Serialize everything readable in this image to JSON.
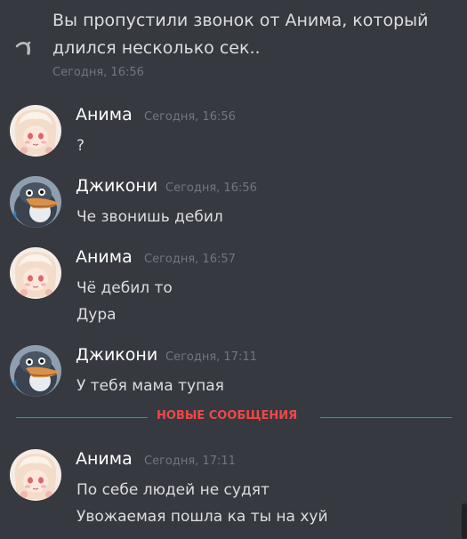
{
  "system_message": {
    "text_line1": "Вы пропустили звонок от Анима, который",
    "text_line2": "длился несколько сек..",
    "timestamp": "Сегодня, 16:56",
    "icon": "missed-call-icon"
  },
  "messages": [
    {
      "author": "Анима",
      "timestamp": "Сегодня, 16:56",
      "avatar": "anime-girl-avatar",
      "lines": [
        "?"
      ]
    },
    {
      "author": "Джикони",
      "timestamp": "Сегодня, 16:56",
      "avatar": "penguin-avatar",
      "lines": [
        "Че звонишь дебил"
      ]
    },
    {
      "author": "Анима",
      "timestamp": "Сегодня, 16:57",
      "avatar": "anime-girl-avatar",
      "lines": [
        "Чё дебил то",
        "Дура"
      ]
    },
    {
      "author": "Джикони",
      "timestamp": "Сегодня, 17:11",
      "avatar": "penguin-avatar",
      "lines": [
        "У тебя мама тупая"
      ]
    },
    {
      "author": "Анима",
      "timestamp": "Сегодня, 17:11",
      "avatar": "anime-girl-avatar",
      "lines": [
        "По себе людей не судят",
        "Увожаемая пошла ка ты на хуй"
      ]
    }
  ],
  "new_messages_divider": {
    "label": "НОВЫЕ СООБЩЕНИЯ"
  },
  "colors": {
    "background": "#36393f",
    "text": "#dcddde",
    "username": "#ffffff",
    "timestamp": "#72767d",
    "new_divider": "#f04747"
  }
}
